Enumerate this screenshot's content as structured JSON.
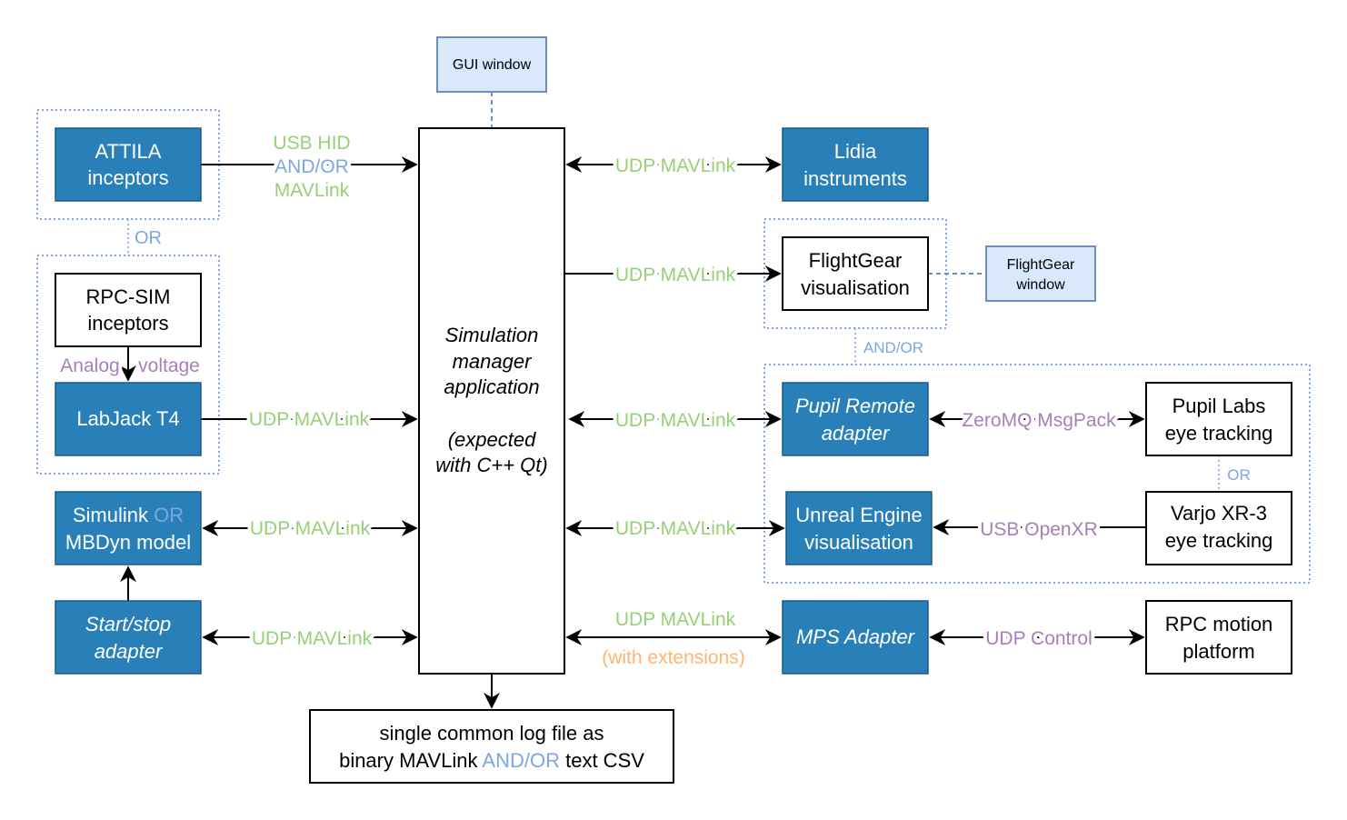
{
  "colors": {
    "component": "#2980B9",
    "link_green": "#97D077",
    "link_blue": "#7EA6E0",
    "link_purple": "#A680B8",
    "link_orange": "#FFB570",
    "window": "#DAE8FC"
  },
  "nodes": {
    "gui_window": "GUI window",
    "attila": [
      "ATTILA",
      "inceptors"
    ],
    "rpc_sim": [
      "RPC-SIM",
      "inceptors"
    ],
    "labjack": "LabJack T4",
    "simulink": {
      "a": "Simulink",
      "or": "OR",
      "b": "MBDyn model"
    },
    "startstop": [
      "Start/stop",
      "adapter"
    ],
    "manager": [
      "Simulation",
      "manager",
      "application",
      "(expected",
      "with C++ Qt)"
    ],
    "log": {
      "line1": "single common log file as",
      "pre": "binary MAVLink",
      "or": "AND/OR",
      "post": "text CSV"
    },
    "lidia": [
      "Lidia",
      "instruments"
    ],
    "flightgear": [
      "FlightGear",
      "visualisation"
    ],
    "flightgear_window": [
      "FlightGear",
      "window"
    ],
    "pupil_remote": [
      "Pupil Remote",
      "adapter"
    ],
    "unreal": [
      "Unreal Engine",
      "visualisation"
    ],
    "pupil_labs": [
      "Pupil Labs",
      "eye tracking"
    ],
    "varjo": [
      "Varjo XR-3",
      "eye tracking"
    ],
    "mps": "MPS Adapter",
    "rpc_motion": [
      "RPC motion",
      "platform"
    ]
  },
  "labels": {
    "usb_hid": "USB HID",
    "and_or": "AND/OR",
    "mavlink": "MAVLink",
    "or": "OR",
    "analog": "Analog",
    "voltage": "voltage",
    "udp_mavlink": "UDP MAVLink",
    "with_ext": "(with extensions)",
    "zeromq": "ZeroMQ MsgPack",
    "usb_openxr": "USB OpenXR",
    "udp_control": "UDP Control"
  }
}
